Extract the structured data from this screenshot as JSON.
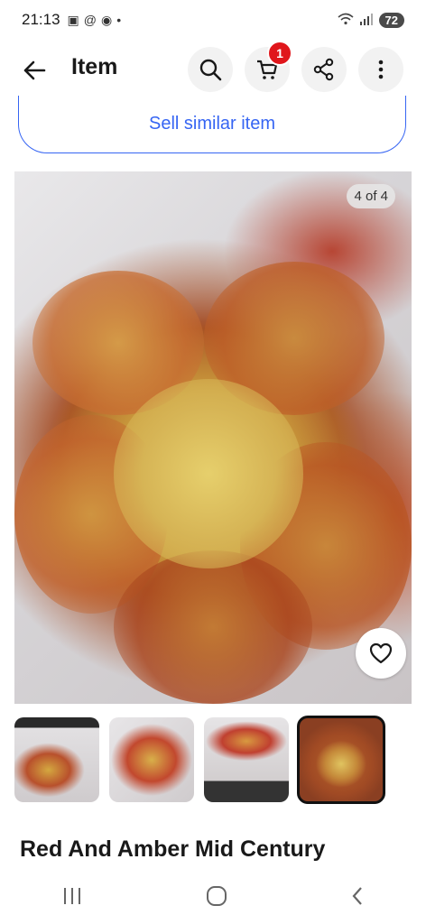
{
  "status_bar": {
    "time": "21:13",
    "battery": "72"
  },
  "header": {
    "title": "Item",
    "cart_count": "1"
  },
  "sell_button": {
    "label": "Sell similar item"
  },
  "gallery": {
    "counter": "4 of 4",
    "current_index": 4,
    "total": 4
  },
  "item": {
    "title": "Red And Amber Mid Century"
  },
  "icons": {
    "back": "back-arrow-icon",
    "search": "search-icon",
    "cart": "cart-icon",
    "share": "share-icon",
    "more": "more-vertical-icon",
    "favorite": "heart-icon"
  },
  "colors": {
    "accent": "#3665f3",
    "badge": "#e0161b"
  }
}
